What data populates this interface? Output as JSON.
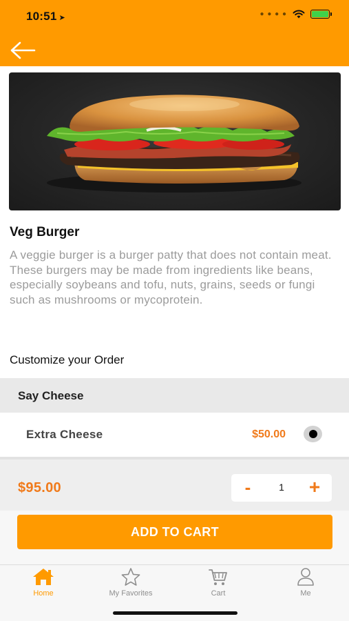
{
  "status_bar": {
    "time": "10:51",
    "location_arrow": "location-arrow-icon"
  },
  "nav": {
    "back_icon": "back-arrow-icon"
  },
  "product": {
    "image_alt": "burger-photo",
    "title": "Veg Burger",
    "description": "A veggie burger is a burger patty that does not contain meat. These burgers may be made from ingredients like beans, especially soybeans and tofu, nuts, grains, seeds or fungi such as mushrooms or mycoprotein."
  },
  "customize": {
    "label": "Customize your Order",
    "group_title": "Say Cheese",
    "options": [
      {
        "name": "Extra Cheese",
        "price": "$50.00",
        "selected": true
      }
    ]
  },
  "order": {
    "total": "$95.00",
    "quantity": "1",
    "minus_symbol": "-",
    "plus_symbol": "+"
  },
  "add_to_cart": {
    "label": "ADD TO CART"
  },
  "tabs": [
    {
      "label": "Home",
      "icon": "home-icon",
      "active": true
    },
    {
      "label": "My Favorites",
      "icon": "star-icon",
      "active": false
    },
    {
      "label": "Cart",
      "icon": "cart-icon",
      "active": false
    },
    {
      "label": "Me",
      "icon": "person-icon",
      "active": false
    }
  ],
  "colors": {
    "brand_orange": "#FF9A00",
    "price_orange": "#F07A1A",
    "description_gray": "#9b9b9b"
  }
}
